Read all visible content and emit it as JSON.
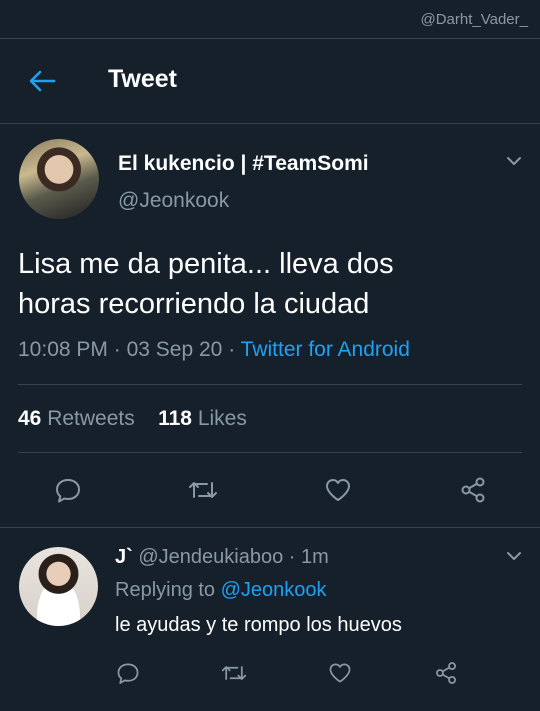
{
  "watermark": "@Darht_Vader_",
  "header": {
    "title": "Tweet"
  },
  "tweet": {
    "author_name": "El kukencio | #TeamSomi",
    "author_handle": "@Jeonkook",
    "text_line1": "Lisa me da penita... lleva dos",
    "text_line2": "horas recorriendo la ciudad",
    "time": "10:08 PM",
    "separator": "·",
    "date": "03 Sep 20",
    "source": "Twitter for Android",
    "retweets_count": "46",
    "retweets_label": "Retweets",
    "likes_count": "118",
    "likes_label": "Likes"
  },
  "reply": {
    "author_name": "J`",
    "author_handle": "@Jendeukiaboo",
    "separator": "·",
    "age": "1m",
    "replying_prefix": "Replying to",
    "replying_mention": "@Jeonkook",
    "text": "le ayudas y te rompo los huevos"
  },
  "icons": {
    "back": "back-arrow-icon",
    "caret": "chevron-down-icon",
    "reply": "reply-icon",
    "retweet": "retweet-icon",
    "like": "like-icon",
    "share": "share-icon"
  },
  "colors": {
    "background": "#15202b",
    "accent": "#1da1f2",
    "secondary_text": "#8899a6",
    "divider": "#38444d"
  }
}
